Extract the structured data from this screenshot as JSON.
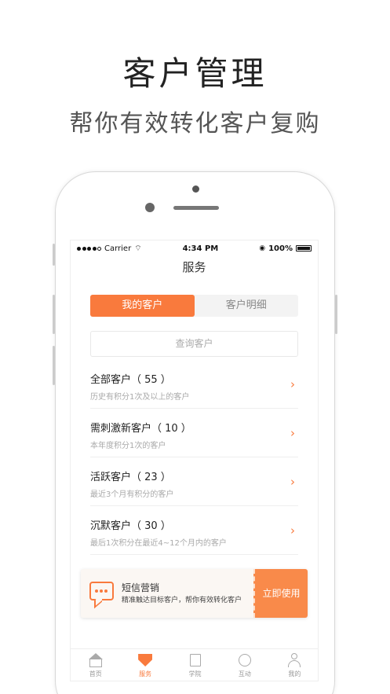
{
  "promo": {
    "headline": "客户管理",
    "subline": "帮你有效转化客户复购"
  },
  "status_bar": {
    "carrier": "Carrier",
    "time": "4:34 PM",
    "battery": "100%"
  },
  "nav": {
    "title": "服务"
  },
  "segments": [
    {
      "label": "我的客户",
      "active": true
    },
    {
      "label": "客户明细",
      "active": false
    }
  ],
  "search": {
    "placeholder": "查询客户"
  },
  "customer_list": [
    {
      "title": "全部客户（ 55 ）",
      "desc": "历史有积分1次及以上的客户"
    },
    {
      "title": "需刺激新客户（ 10 ）",
      "desc": "本年度积分1次的客户"
    },
    {
      "title": "活跃客户（ 23 ）",
      "desc": "最近3个月有积分的客户"
    },
    {
      "title": "沉默客户（ 30 ）",
      "desc": "最后1次积分在最近4~12个月内的客户"
    }
  ],
  "sms_card": {
    "title": "短信营销",
    "desc": "精准触达目标客户，帮你有效转化客户",
    "button": "立即使用"
  },
  "tabbar": [
    {
      "label": "首页",
      "icon": "home-icon"
    },
    {
      "label": "服务",
      "icon": "service-icon",
      "active": true
    },
    {
      "label": "学院",
      "icon": "book-icon"
    },
    {
      "label": "互动",
      "icon": "chat-icon"
    },
    {
      "label": "我的",
      "icon": "user-icon"
    }
  ],
  "colors": {
    "accent": "#f97a3d"
  }
}
